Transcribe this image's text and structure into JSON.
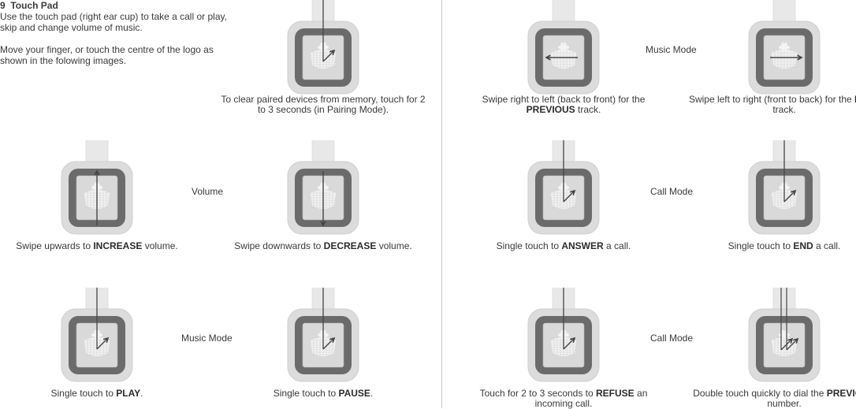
{
  "section": {
    "number": "9",
    "title": "Touch Pad",
    "para1": "Use the touch pad (right ear cup) to take a call or play, skip and change volume of music.",
    "para2": "Move your finger, or touch the centre of the logo as shown in the folowing images."
  },
  "colors": {
    "band": "#e8e8e8",
    "cup_outer": "#dcdcdc",
    "cup_ring": "#6b6b6b",
    "pad_face": "#d9d9d9",
    "arrow": "#444444",
    "logo": "#f7f7f7",
    "divider": "#c8c8c8"
  },
  "modes": {
    "volume": "Volume",
    "music_left": "Music Mode",
    "music_right": "Music Mode",
    "call_1": "Call Mode",
    "call_2": "Call Mode"
  },
  "items": [
    {
      "id": "clear-paired",
      "gesture": "touch-hold",
      "icon": "touch-arrow-icon",
      "pre": "To clear paired devices from memory, touch for 2 to 3 seconds (in Pairing Mode).",
      "bold": "",
      "post": ""
    },
    {
      "id": "increase-volume",
      "gesture": "swipe-up",
      "icon": "arrow-up-icon",
      "pre": "Swipe upwards to ",
      "bold": "INCREASE",
      "post": " volume."
    },
    {
      "id": "decrease-volume",
      "gesture": "swipe-down",
      "icon": "arrow-down-icon",
      "pre": "Swipe downwards to ",
      "bold": "DECREASE",
      "post": " volume."
    },
    {
      "id": "play",
      "gesture": "single-touch",
      "icon": "touch-arrow-icon",
      "pre": "Single touch to ",
      "bold": "PLAY",
      "post": "."
    },
    {
      "id": "pause",
      "gesture": "single-touch",
      "icon": "touch-arrow-icon",
      "pre": "Single touch to ",
      "bold": "PAUSE",
      "post": "."
    },
    {
      "id": "previous-track",
      "gesture": "swipe-left",
      "icon": "arrow-left-icon",
      "pre": "Swipe right to left (back to front) for the ",
      "bold": "PREVIOUS",
      "post": " track."
    },
    {
      "id": "next-track",
      "gesture": "swipe-right",
      "icon": "arrow-right-icon",
      "pre": "Swipe left to right (front to back) for the ",
      "bold": "NEXT",
      "post": " track."
    },
    {
      "id": "answer-call",
      "gesture": "single-touch",
      "icon": "touch-arrow-icon",
      "pre": "Single touch to ",
      "bold": "ANSWER",
      "post": " a call."
    },
    {
      "id": "end-call",
      "gesture": "single-touch",
      "icon": "touch-arrow-icon",
      "pre": "Single touch to ",
      "bold": "END",
      "post": " a call."
    },
    {
      "id": "refuse-call",
      "gesture": "touch-hold",
      "icon": "touch-arrow-icon",
      "pre": "Touch for 2 to 3 seconds to ",
      "bold": "REFUSE",
      "post": " an incoming call."
    },
    {
      "id": "redial",
      "gesture": "double-touch",
      "icon": "double-touch-arrow-icon",
      "pre": "Double touch quickly to dial the ",
      "bold": "PREVIOUS",
      "post": " number."
    }
  ]
}
